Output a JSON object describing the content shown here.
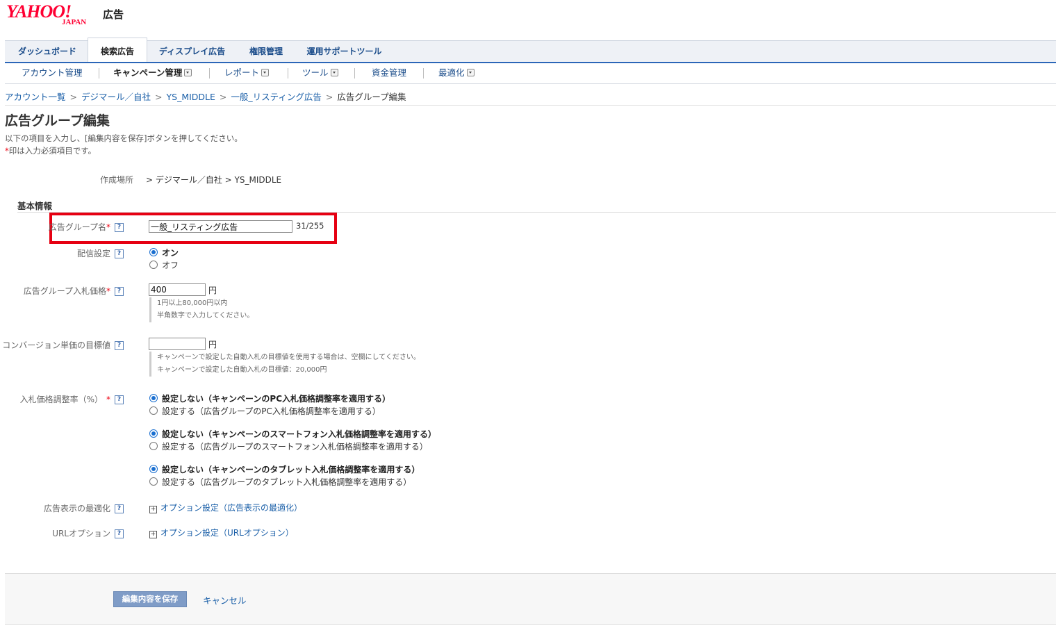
{
  "logo": {
    "brand": "YAHOO!",
    "sub": "JAPAN",
    "service": "広告"
  },
  "tabs": [
    "ダッシュボード",
    "検索広告",
    "ディスプレイ広告",
    "権限管理",
    "運用サポートツール"
  ],
  "submenu": [
    "アカウント管理",
    "キャンペーン管理",
    "レポート",
    "ツール",
    "資金管理",
    "最適化"
  ],
  "breadcrumb": [
    "アカウント一覧",
    "デジマール／自社",
    "YS_MIDDLE",
    "一般_リスティング広告",
    "広告グループ編集"
  ],
  "breadcrumb_sep": ">",
  "page": {
    "title": "広告グループ編集",
    "instruction": "以下の項目を入力し、[編集内容を保存]ボタンを押してください。",
    "required_note": "印は入力必須項目です。",
    "required_mark": "*"
  },
  "location": {
    "label": "作成場所",
    "value": "> デジマール／自社 > YS_MIDDLE"
  },
  "section_title": "基本情報",
  "help_mark": "?",
  "fields": {
    "group_name": {
      "label": "広告グループ名",
      "value": "一般_リスティング広告",
      "counter": "31/255"
    },
    "delivery": {
      "label": "配信設定",
      "on": "オン",
      "off": "オフ"
    },
    "bid": {
      "label": "広告グループ入札価格",
      "value": "400",
      "unit": "円",
      "note1": "1円以上80,000円以内",
      "note2": "半角数字で入力してください。"
    },
    "cv_target": {
      "label": "コンバージョン単価の目標値",
      "value": "",
      "unit": "円",
      "note1": "キャンペーンで設定した自動入札の目標値を使用する場合は、空欄にしてください。",
      "note2": "キャンペーンで設定した自動入札の目標値：20,000円"
    },
    "bid_adj": {
      "label": "入札価格調整率（%）",
      "pc_off": "設定しない（キャンペーンのPC入札価格調整率を適用する）",
      "pc_on": "設定する（広告グループのPC入札価格調整率を適用する）",
      "sp_off": "設定しない（キャンペーンのスマートフォン入札価格調整率を適用する）",
      "sp_on": "設定する（広告グループのスマートフォン入札価格調整率を適用する）",
      "tb_off": "設定しない（キャンペーンのタブレット入札価格調整率を適用する）",
      "tb_on": "設定する（広告グループのタブレット入札価格調整率を適用する）"
    },
    "ad_opt": {
      "label": "広告表示の最適化",
      "link": "オプション設定（広告表示の最適化）"
    },
    "url_opt": {
      "label": "URLオプション",
      "link": "オプション設定（URLオプション）"
    }
  },
  "buttons": {
    "save": "編集内容を保存",
    "cancel": "キャンセル"
  }
}
